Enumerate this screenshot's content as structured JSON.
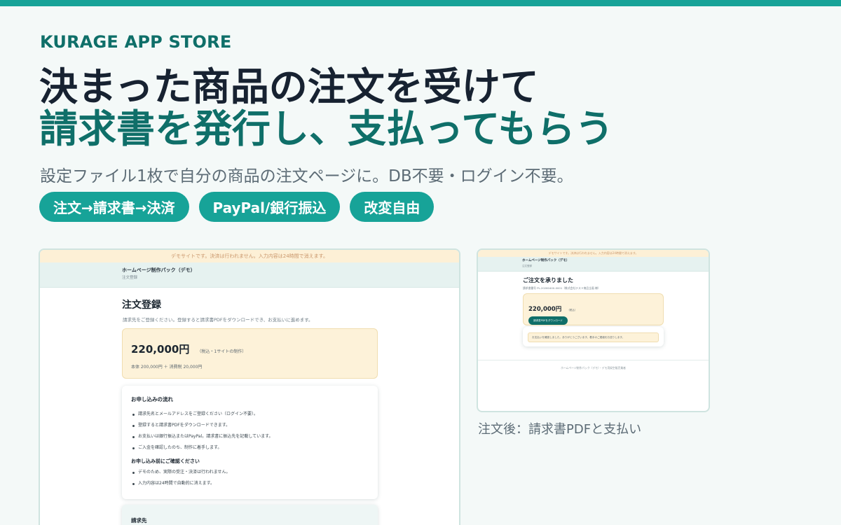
{
  "colors": {
    "accent": "#17a398",
    "brand": "#0f6f69",
    "heading": "#172231",
    "muted": "#5d6c76",
    "price_bg": "#fdf2d9",
    "demo_banner_bg": "#fdf0d6"
  },
  "brand": "KURAGE APP STORE",
  "headline": {
    "line1": "決まった商品の注文を受けて",
    "line2": "請求書を発行し、支払ってもらう"
  },
  "lead": "設定ファイル1枚で自分の商品の注文ページに。DB不要・ログイン不要。",
  "pills": [
    "注文→請求書→決済",
    "PayPal/銀行振込",
    "改変自由"
  ],
  "order_shot": {
    "demo_banner": "デモサイトです。決済は行われません。入力内容は24時間で消えます。",
    "site_title": "ホームページ制作パック（デモ）",
    "breadcrumb": "注文登録",
    "heading": "注文登録",
    "description": "請求先をご登録ください。登録すると請求書PDFをダウンロードでき、お支払いに進めます。",
    "price": "220,000円",
    "price_note": "（税込・1サイトの制作）",
    "price_breakdown": "本体 200,000円 ＋ 消費税 20,000円",
    "flow_title": "お申し込みの流れ",
    "flow_items": [
      "請求先名とメールアドレスをご登録ください（ログイン不要）。",
      "登録すると請求書PDFをダウンロードできます。",
      "お支払いは銀行振込またはPayPal。請求書に振込先を記載しています。",
      "ご入金を確認したのち、制作に着手します。"
    ],
    "confirm_title": "お申し込み前にご確認ください",
    "confirm_items": [
      "デモのため、実際の受注・決済は行われません。",
      "入力内容は24時間で自動的に消えます。"
    ],
    "billing_title": "請求先"
  },
  "complete_shot": {
    "demo_banner": "デモサイトです。決済は行われません。入力内容は24時間で消えます。",
    "site_title": "ホームページ制作パック（デモ）",
    "breadcrumb": "注文登録",
    "heading": "ご注文を承りました",
    "order_no": "請求書番号 PL-20260400-0001（株式会社テスト商品企画 様）",
    "price": "220,000円",
    "price_note": "（税込）",
    "download_label": "請求書PDFをダウンロード",
    "thanks": "お支払いを確認しました。ありがとうございます。着手のご連絡をお送りします。",
    "footer": "ホームページ制作パック（デモ）・デモ用架空販売業者"
  },
  "caption": "注文後：請求書PDFと支払い"
}
